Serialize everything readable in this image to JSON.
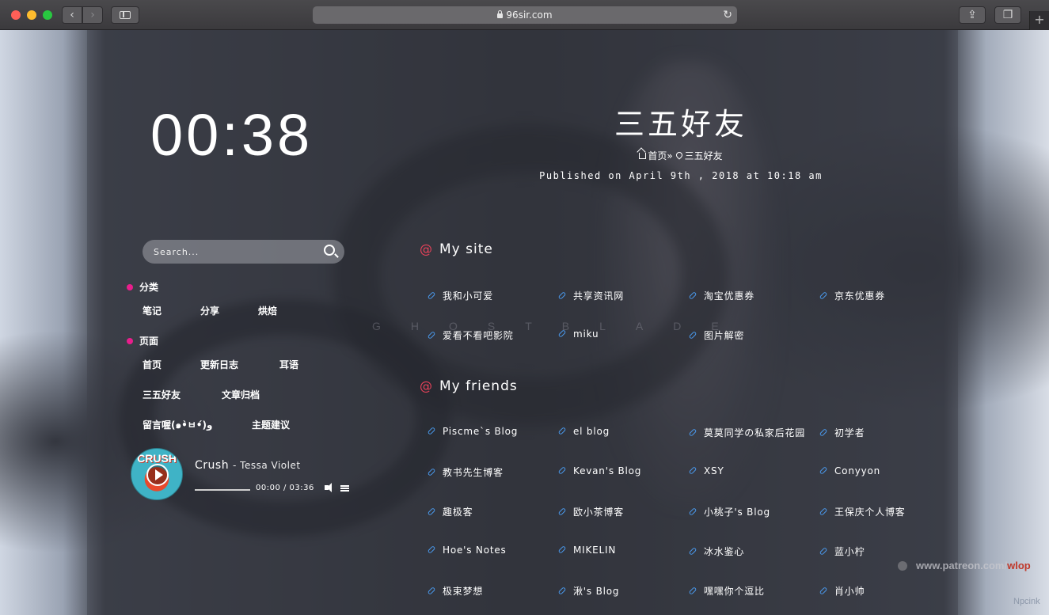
{
  "browser": {
    "url": "96sir.com"
  },
  "clock": "00:38",
  "search": {
    "placeholder": "Search..."
  },
  "sidebar": {
    "categories_title": "分类",
    "categories": [
      "笔记",
      "分享",
      "烘焙"
    ],
    "pages_title": "页面",
    "pages": [
      "首页",
      "更新日志",
      "耳语",
      "三五好友",
      "文章归档",
      "留言喔(๑•̀ㅂ•́)و",
      "主题建议"
    ]
  },
  "player": {
    "cover_text": "CRUSH",
    "song": "Crush",
    "artist": "- Tessa Violet",
    "time": "00:00 / 03:36",
    "progress": 0
  },
  "post": {
    "title": "三五好友",
    "breadcrumb_home": "首页",
    "breadcrumb_sep": "»",
    "breadcrumb_current": "三五好友",
    "published": "Published on April 9th , 2018 at 10:18 am"
  },
  "ghost_text": "GHOSTBLADE",
  "my_site": {
    "title": "My site",
    "links": [
      "我和小可爱",
      "共享资讯网",
      "淘宝优惠券",
      "京东优惠券",
      "爱看不看吧影院",
      "miku",
      "图片解密"
    ]
  },
  "my_friends": {
    "title": "My friends",
    "links": [
      "Piscme`s Blog",
      "el blog",
      "莫莫同学の私家后花园",
      "初学者",
      "教书先生博客",
      "Kevan's Blog",
      "XSY",
      "Conyyon",
      "趣极客",
      "欧小茶博客",
      "小桃子's Blog",
      "王保庆个人博客",
      "Hoe's Notes",
      "MIKELIN",
      "冰水鉴心",
      "蓝小柠",
      "极束梦想",
      "湫's Blog",
      "嘿嘿你个逗比",
      "肖小帅"
    ]
  },
  "watermark": {
    "prefix": "www.patreon.com/",
    "name": "wlop"
  },
  "corner_credit": "Npcink",
  "colors": {
    "accent_at": "#e8425a",
    "dot": "#e91e8c",
    "link_icon": "#4a9bf0"
  }
}
